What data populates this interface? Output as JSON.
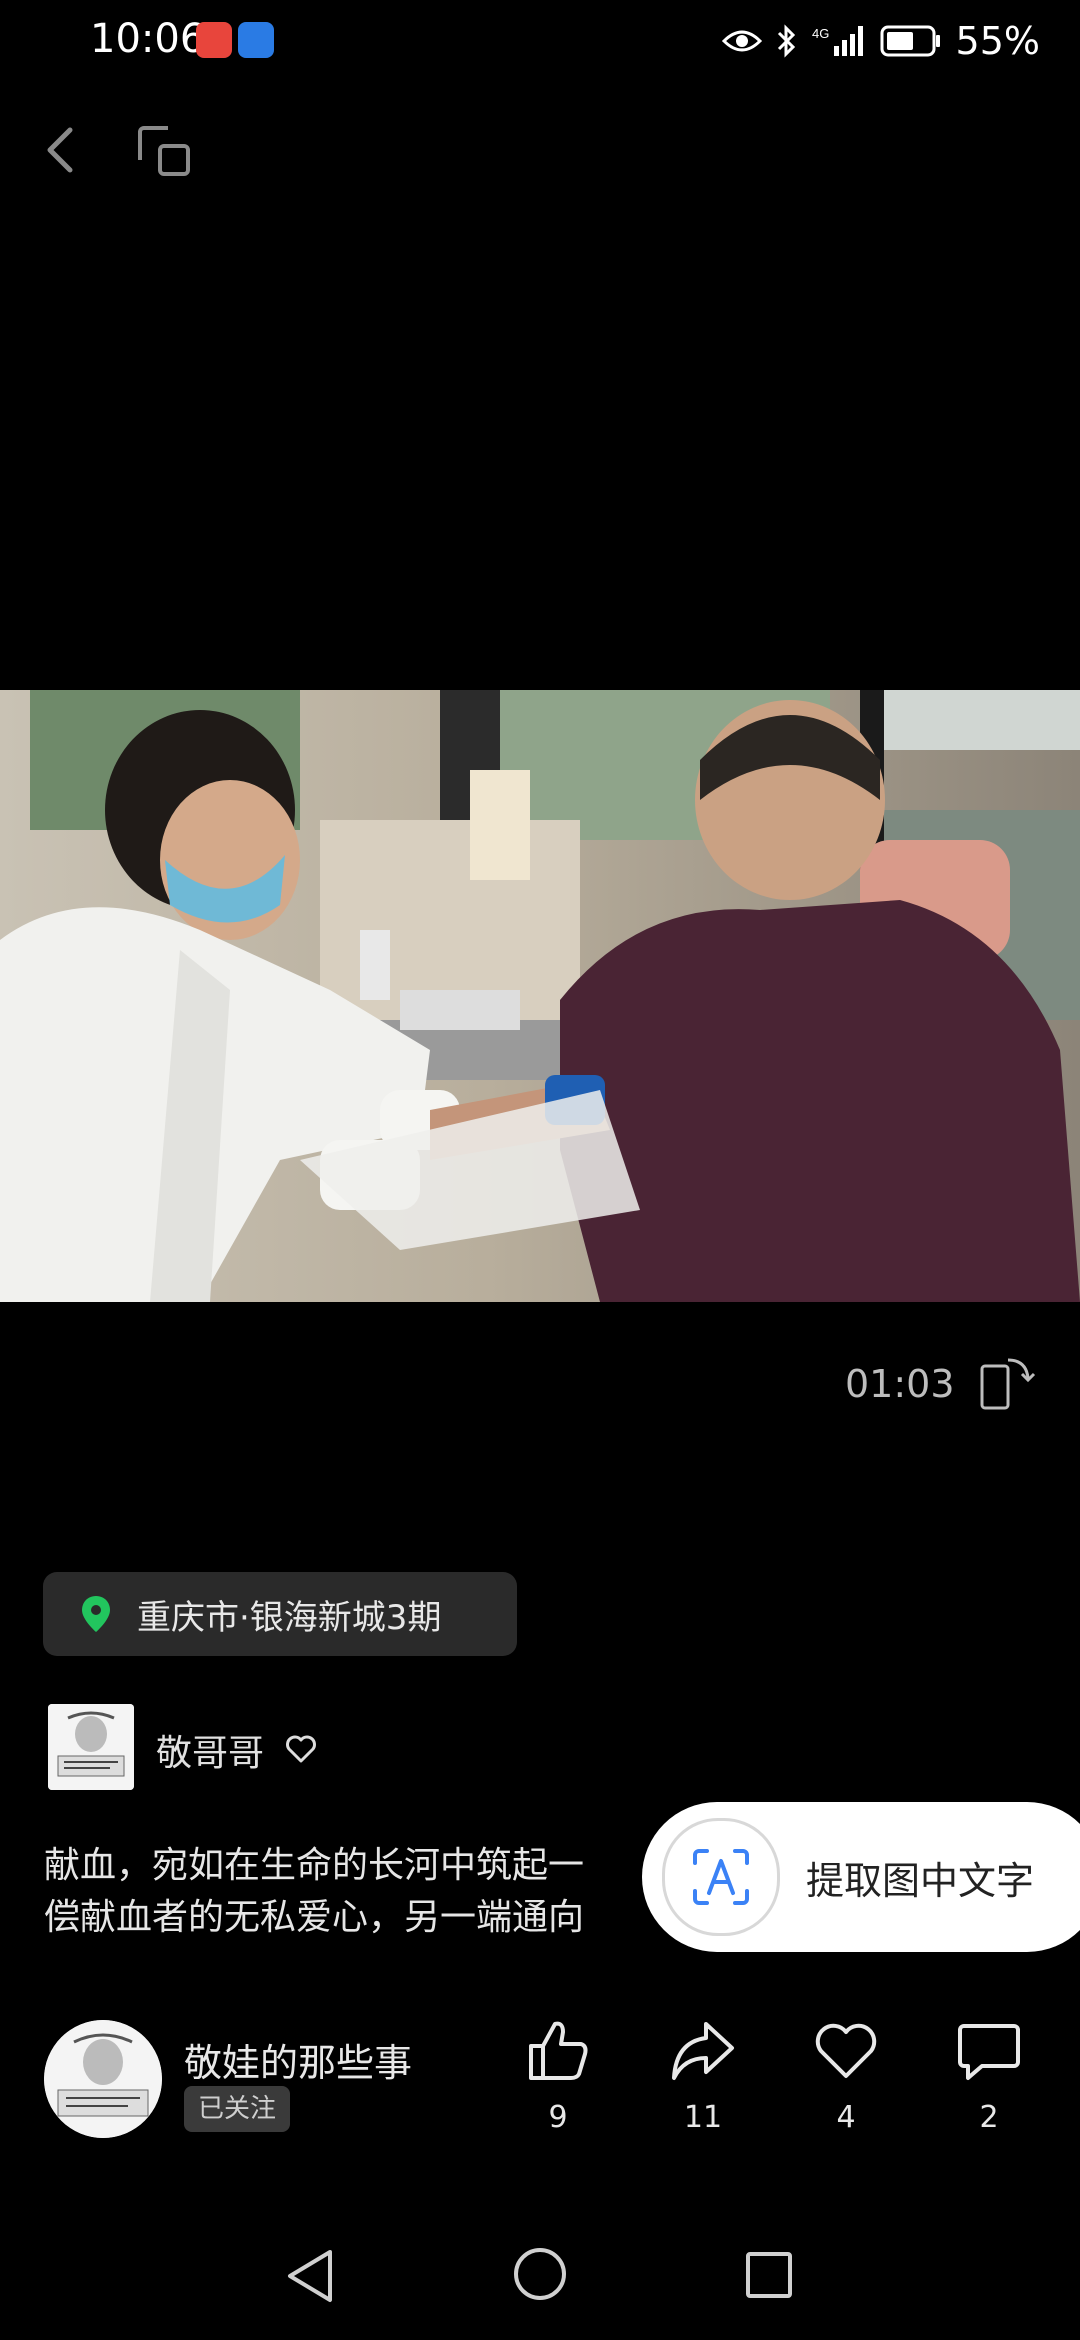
{
  "status_bar": {
    "time": "10:06",
    "battery_percent": "55%",
    "notifications": [
      "huawei-app-icon",
      "browser-app-icon"
    ],
    "indicators": [
      "eye-icon",
      "bluetooth-icon",
      "signal-4g-icon",
      "battery-icon"
    ]
  },
  "top_nav": {
    "back_icon": "chevron-left-icon",
    "window_icon": "floating-window-icon"
  },
  "media": {
    "timecode": "01:03",
    "rotate_icon": "rotate-screen-icon"
  },
  "location": {
    "text": "重庆市·银海新城3期",
    "icon": "map-pin-icon",
    "icon_color": "#22c55e"
  },
  "author": {
    "name": "敬哥哥"
  },
  "caption": {
    "line1": "献血，宛如在生命的长河中筑起一",
    "line2": "偿献血者的无私爱心，另一端通向"
  },
  "extract_text": {
    "label": "提取图中文字",
    "icon": "text-scan-icon",
    "accent": "#3b82f6"
  },
  "account": {
    "name": "敬娃的那些事",
    "follow_status": "已关注"
  },
  "actions": {
    "like_count": "9",
    "share_count": "11",
    "favorite_count": "4",
    "comment_count": "2"
  },
  "system_nav": [
    "triangle-back-icon",
    "circle-home-icon",
    "square-recent-icon"
  ]
}
